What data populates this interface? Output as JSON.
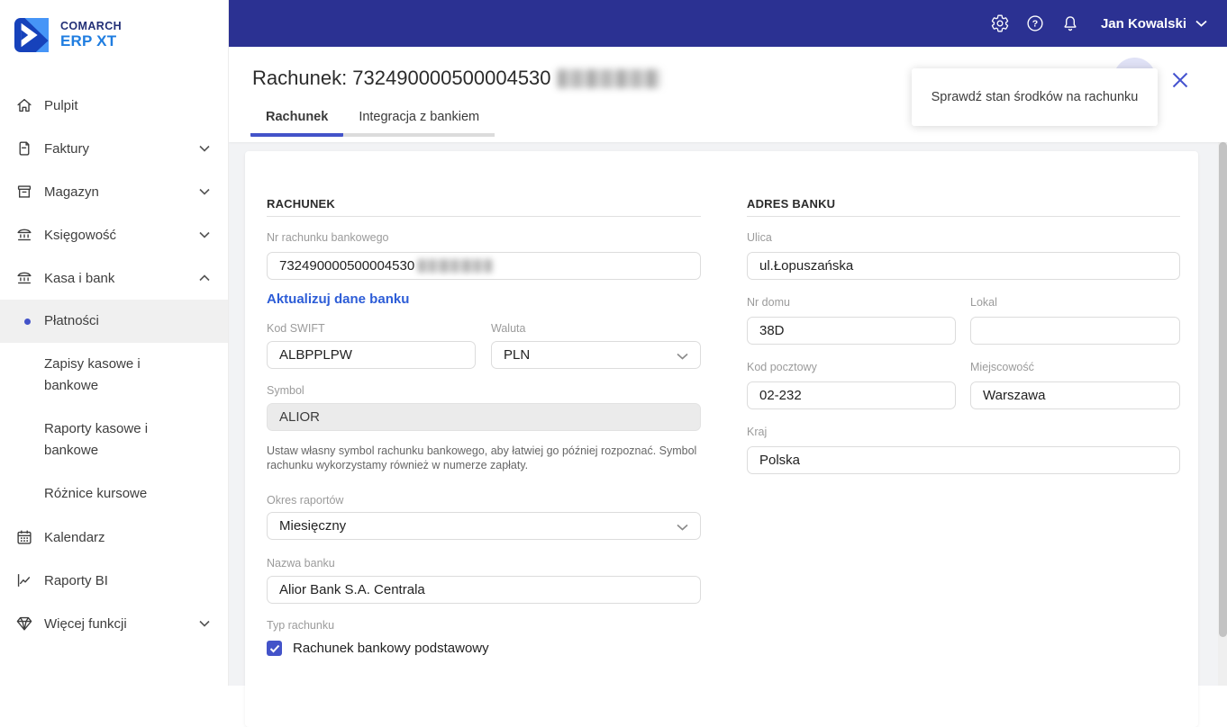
{
  "brand": {
    "line1": "COMARCH",
    "line2": "ERP XT"
  },
  "topbar": {
    "user_name": "Jan Kowalski"
  },
  "sidebar": {
    "items": [
      {
        "label": "Pulpit"
      },
      {
        "label": "Faktury"
      },
      {
        "label": "Magazyn"
      },
      {
        "label": "Księgowość"
      },
      {
        "label": "Kasa i bank"
      },
      {
        "label": "Płatności"
      },
      {
        "label": "Zapisy kasowe i bankowe"
      },
      {
        "label": "Raporty kasowe i bankowe"
      },
      {
        "label": "Różnice kursowe"
      },
      {
        "label": "Kalendarz"
      },
      {
        "label": "Raporty BI"
      },
      {
        "label": "Więcej funkcji"
      }
    ]
  },
  "page": {
    "title": "Rachunek: 732490000500004530",
    "tabs": [
      {
        "label": "Rachunek"
      },
      {
        "label": "Integracja z bankiem"
      }
    ]
  },
  "tooltip": {
    "text": "Sprawdź stan środków na rachunku"
  },
  "form": {
    "left": {
      "section_title": "RACHUNEK",
      "account_number": {
        "label": "Nr rachunku bankowego",
        "value": "732490000500004530"
      },
      "update_link": "Aktualizuj dane banku",
      "swift": {
        "label": "Kod SWIFT",
        "value": "ALBPPLPW"
      },
      "currency": {
        "label": "Waluta",
        "value": "PLN"
      },
      "symbol": {
        "label": "Symbol",
        "value": "ALIOR"
      },
      "symbol_hint": "Ustaw własny symbol rachunku bankowego, aby łatwiej go później rozpoznać. Symbol rachunku wykorzystamy również w numerze zapłaty.",
      "report_period": {
        "label": "Okres raportów",
        "value": "Miesięczny"
      },
      "bank_name": {
        "label": "Nazwa banku",
        "value": "Alior Bank S.A. Centrala"
      },
      "account_type_label": "Typ rachunku",
      "account_type_checkbox": "Rachunek bankowy podstawowy"
    },
    "right": {
      "section_title": "ADRES BANKU",
      "street": {
        "label": "Ulica",
        "value": "ul.Łopuszańska"
      },
      "house_no": {
        "label": "Nr domu",
        "value": "38D"
      },
      "apartment": {
        "label": "Lokal",
        "value": ""
      },
      "postal_code": {
        "label": "Kod pocztowy",
        "value": "02-232"
      },
      "city": {
        "label": "Miejscowość",
        "value": "Warszawa"
      },
      "country": {
        "label": "Kraj",
        "value": "Polska"
      }
    }
  },
  "colors": {
    "topbar": "#2b3192",
    "accent": "#4353c9",
    "link": "#2d5dd7"
  }
}
